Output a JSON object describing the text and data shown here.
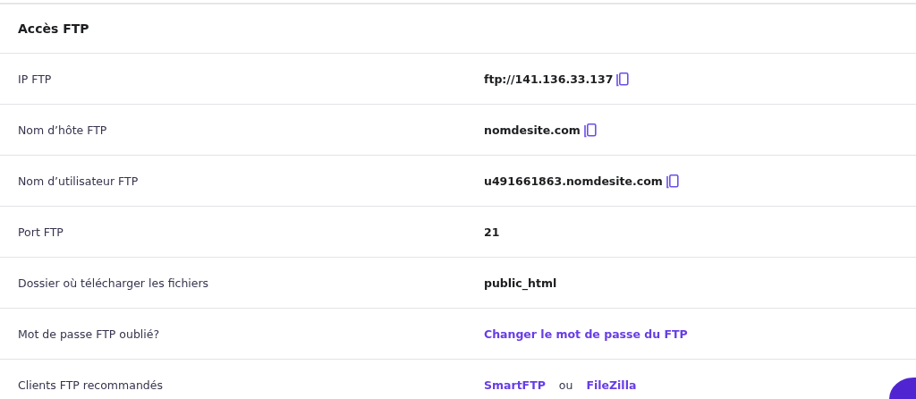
{
  "card": {
    "title": "Accès FTP",
    "rows": [
      {
        "label": "IP FTP",
        "copyable": true,
        "value": [
          {
            "kind": "strong",
            "text": "ftp://141.136.33.137"
          }
        ]
      },
      {
        "label": "Nom d’hôte FTP",
        "copyable": true,
        "value": [
          {
            "kind": "strong",
            "text": "nomdesite.com"
          }
        ]
      },
      {
        "label": "Nom d’utilisateur FTP",
        "copyable": true,
        "value": [
          {
            "kind": "strong",
            "text": "u491661863.nomdesite.com"
          }
        ]
      },
      {
        "label": "Port FTP",
        "copyable": false,
        "value": [
          {
            "kind": "strong",
            "text": "21"
          }
        ]
      },
      {
        "label": "Dossier où télécharger les fichiers",
        "copyable": false,
        "value": [
          {
            "kind": "strong",
            "text": "public_html"
          }
        ]
      },
      {
        "label": "Mot de passe FTP oublié?",
        "copyable": false,
        "value": [
          {
            "kind": "link",
            "text": "Changer le mot de passe du FTP"
          }
        ]
      },
      {
        "label": "Clients FTP recommandés",
        "copyable": false,
        "value": [
          {
            "kind": "link",
            "text": "SmartFTP"
          },
          {
            "kind": "plain",
            "text": "ou"
          },
          {
            "kind": "link",
            "text": "FileZilla"
          }
        ]
      }
    ]
  },
  "chat_button": {
    "kind": "round"
  }
}
